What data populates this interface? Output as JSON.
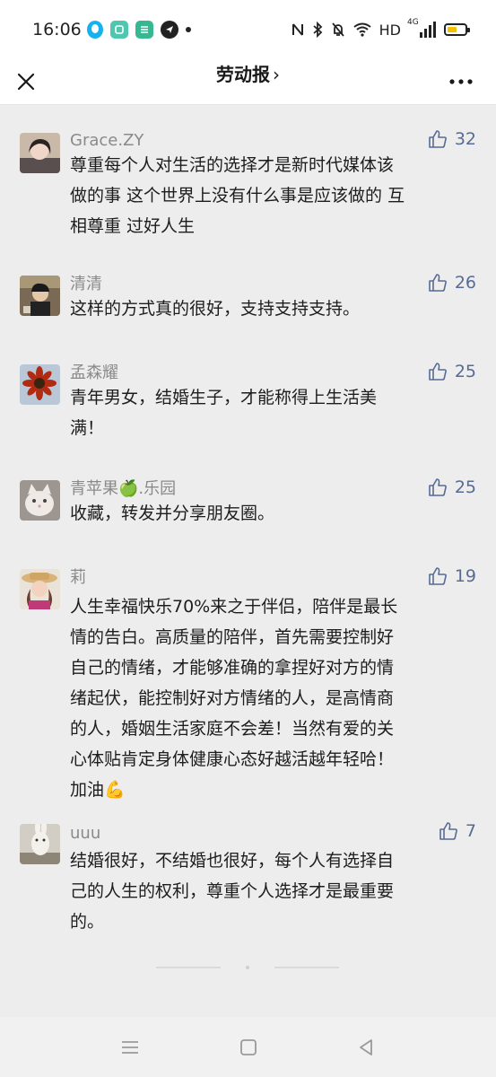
{
  "status_bar": {
    "time": "16:06",
    "right_text": "HD",
    "network": "4G",
    "icons": [
      "qq-icon",
      "wechat-work-icon",
      "wechat-work-icon",
      "navigation-app-icon",
      "nfc-icon",
      "bluetooth-icon",
      "mute-bell-icon",
      "wifi-icon",
      "signal-icon",
      "battery-icon"
    ],
    "battery_level": 0.55,
    "battery_color": "#f2c200"
  },
  "header": {
    "title": "劳动报",
    "title_chevron": "›"
  },
  "comments": [
    {
      "name": "Grace.ZY",
      "likes": "32",
      "text_lines": [
        "尊重每个人对生活的选择才是新时代媒体该",
        "做的事 这个世界上没有什么事是应该做的 互",
        "相尊重 过好人生"
      ]
    },
    {
      "name": "清清",
      "likes": "26",
      "text_lines": [
        "这样的方式真的很好，支持支持支持。"
      ]
    },
    {
      "name": "孟森耀",
      "likes": "25",
      "text_lines": [
        "青年男女，结婚生子，才能称得上生活美",
        "满！"
      ]
    },
    {
      "name_before": "青苹果",
      "name_emoji": "🍏",
      "name_after": ".乐园",
      "likes": "25",
      "text_lines": [
        "收藏，转发并分享朋友圈。"
      ]
    },
    {
      "name": "莉",
      "likes": "19",
      "text_lines": [
        "人生幸福快乐70%来之于伴侣，陪伴是最长",
        "情的告白。高质量的陪伴，首先需要控制好",
        "自己的情绪，才能够准确的拿捏好对方的情",
        "绪起伏，能控制好对方情绪的人，是高情商",
        "的人，婚姻生活家庭不会差！当然有爱的关",
        "心体贴肯定身体健康心态好越活越年轻哈！"
      ],
      "last_line_text": "加油",
      "last_line_emoji": "💪"
    },
    {
      "name": "uuu",
      "likes": "7",
      "text_lines": [
        "结婚很好，不结婚也很好，每个人有选择自",
        "己的人生的权利，尊重个人选择才是最重要",
        "的。"
      ]
    }
  ],
  "colors": {
    "accent_link": "#576b95",
    "background": "#ededed",
    "name_gray": "#8a8a8a"
  }
}
